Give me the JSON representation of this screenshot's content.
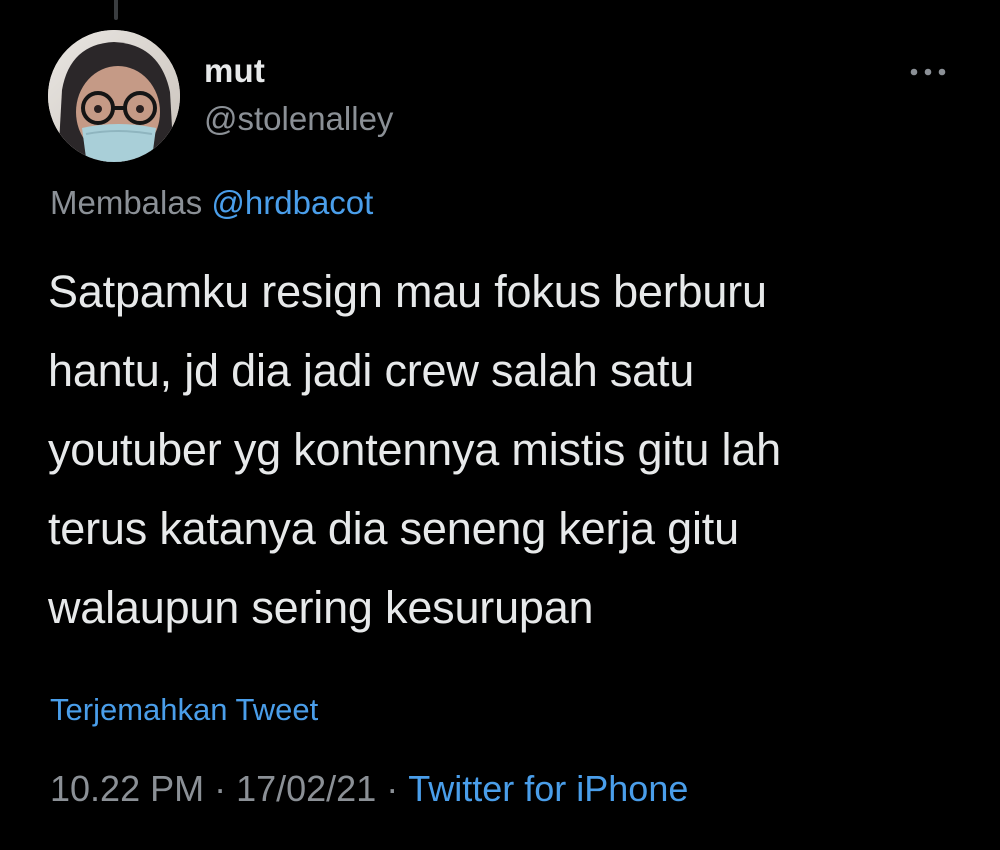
{
  "tweet": {
    "author": {
      "display_name": "mut",
      "handle": "@stolenalley"
    },
    "reply_to": {
      "prefix": "Membalas",
      "mention": "@hrdbacot"
    },
    "text": "Satpamku resign mau fokus berburu\nhantu, jd dia jadi crew salah satu\nyoutuber yg kontennya mistis gitu lah\nterus katanya dia seneng kerja gitu\nwalaupun sering kesurupan",
    "translate_label": "Terjemahkan Tweet",
    "meta": {
      "time": "10.22 PM",
      "separator": "·",
      "date": "17/02/21",
      "source": "Twitter for iPhone"
    }
  },
  "icons": {
    "more": "more-horizontal-icon"
  },
  "colors": {
    "background": "#000000",
    "text": "#e7e9ea",
    "secondary": "#8b9096",
    "link": "#4a9eea"
  }
}
